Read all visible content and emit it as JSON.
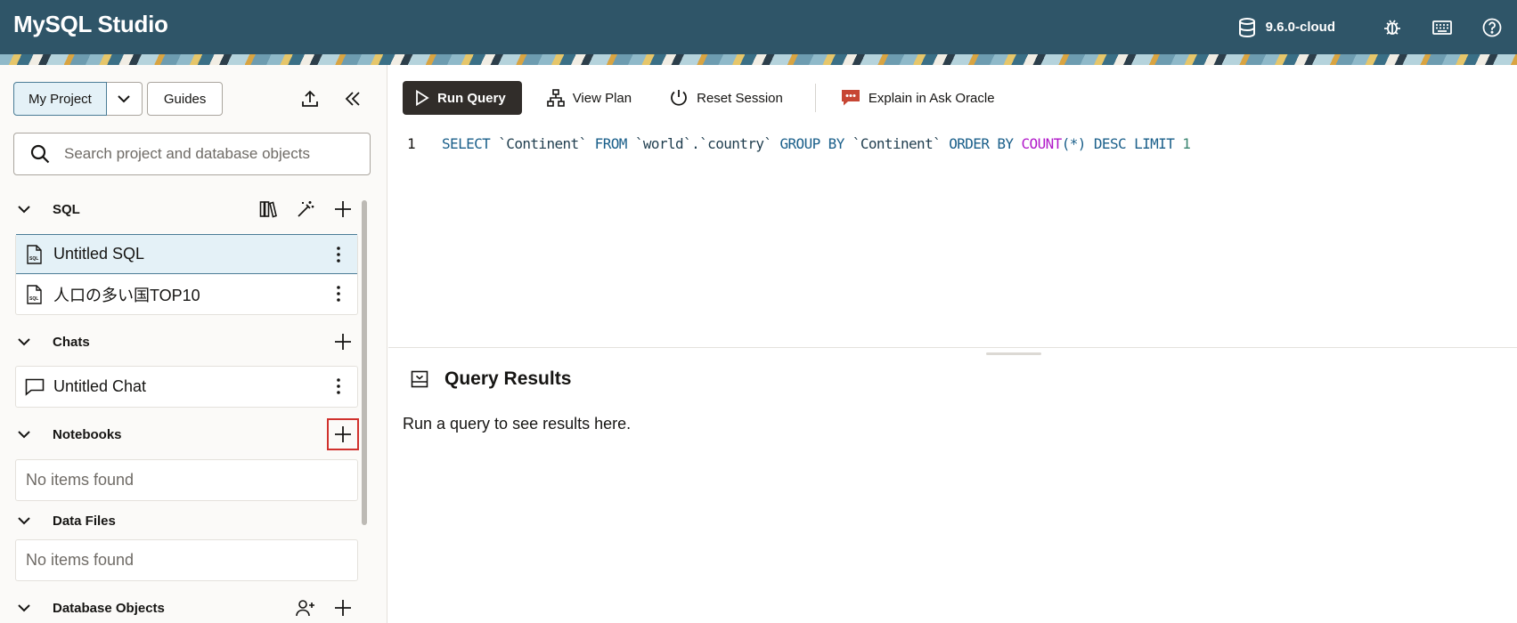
{
  "header": {
    "app_title": "MySQL Studio",
    "version": "9.6.0-cloud",
    "icons": [
      "database-icon",
      "debug-icon",
      "keyboard-icon",
      "help-icon"
    ]
  },
  "sidebar": {
    "project_button": "My Project",
    "guides_button": "Guides",
    "search_placeholder": "Search project and database objects",
    "sections": {
      "sql": {
        "title": "SQL",
        "items": [
          "Untitled SQL",
          "人口の多い国TOP10"
        ]
      },
      "chats": {
        "title": "Chats",
        "items": [
          "Untitled Chat"
        ]
      },
      "notebooks": {
        "title": "Notebooks",
        "empty": "No items found"
      },
      "data_files": {
        "title": "Data Files",
        "empty": "No items found"
      },
      "database_objects": {
        "title": "Database Objects"
      }
    }
  },
  "toolbar": {
    "run_query": "Run Query",
    "view_plan": "View Plan",
    "reset_session": "Reset Session",
    "explain": "Explain in Ask Oracle"
  },
  "editor": {
    "line_number": "1",
    "tokens": {
      "select": "SELECT",
      "col1": "`Continent`",
      "from": "FROM",
      "table": "`world`.`country`",
      "group_by": "GROUP BY",
      "col2": "`Continent`",
      "order_by": "ORDER BY",
      "count": "COUNT",
      "paren_open": "(",
      "star": "*",
      "paren_close": ")",
      "desc": "DESC",
      "limit": "LIMIT",
      "limit_value": "1"
    }
  },
  "results": {
    "title": "Query Results",
    "message": "Run a query to see results here."
  },
  "colors": {
    "header_bg": "#2f5568",
    "run_button_bg": "#312d2a",
    "selected_bg": "#e4f1f7",
    "highlight": "#d0312d",
    "keyword": "#1a5f8a",
    "function": "#b118c9"
  }
}
